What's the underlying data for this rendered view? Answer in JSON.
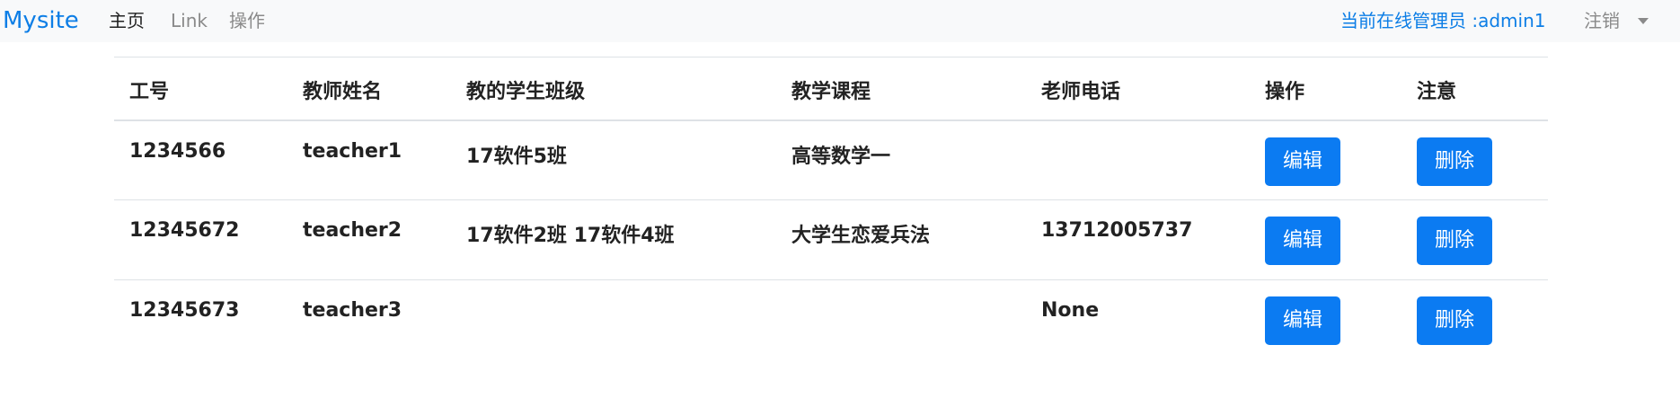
{
  "navbar": {
    "brand": "Mysite",
    "items": [
      "主页",
      "Link",
      "操作"
    ],
    "admin_label": "当前在线管理员 :admin1",
    "logout_label": "注销"
  },
  "table": {
    "headers": [
      "工号",
      "教师姓名",
      "教的学生班级",
      "教学课程",
      "老师电话",
      "操作",
      "注意"
    ],
    "rows": [
      {
        "id": "1234566",
        "name": "teacher1",
        "classes": "17软件5班",
        "course": "高等数学一",
        "phone": "",
        "edit": "编辑",
        "delete": "删除"
      },
      {
        "id": "12345672",
        "name": "teacher2",
        "classes": "17软件2班 17软件4班",
        "course": "大学生恋爱兵法",
        "phone": "13712005737",
        "edit": "编辑",
        "delete": "删除"
      },
      {
        "id": "12345673",
        "name": "teacher3",
        "classes": "",
        "course": "",
        "phone": "None",
        "edit": "编辑",
        "delete": "删除"
      }
    ]
  },
  "colors": {
    "brand": "#0d7ee6",
    "button": "#0b7bf2",
    "navbar_bg": "#f8f9fa"
  }
}
